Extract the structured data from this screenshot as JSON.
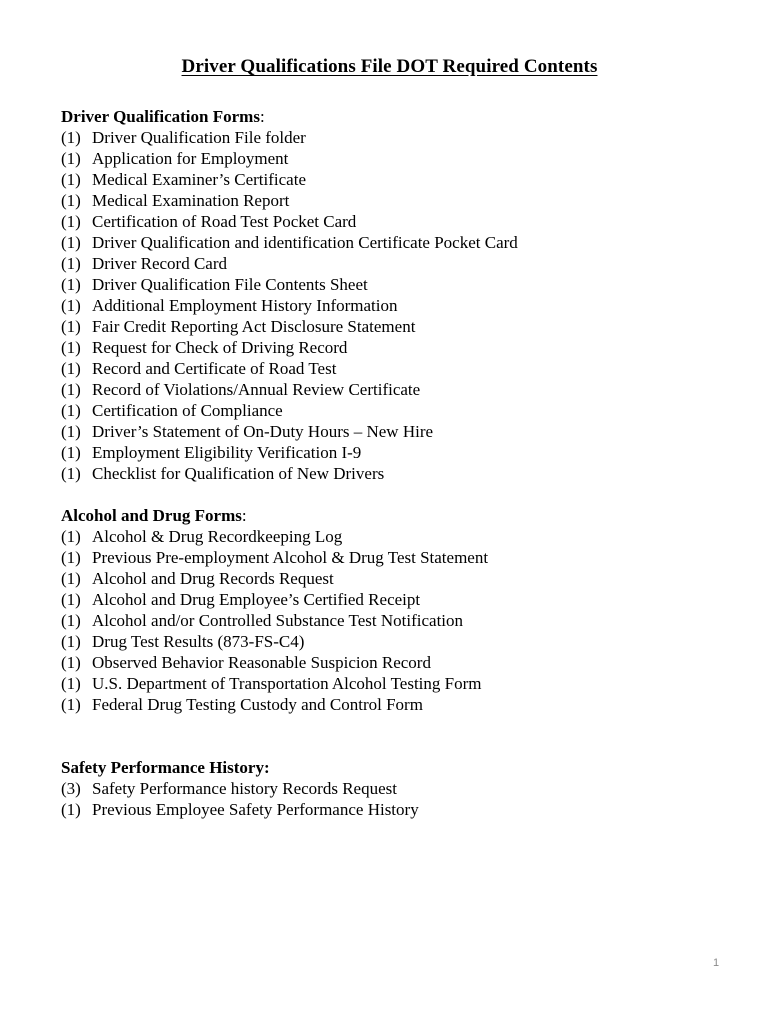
{
  "document": {
    "title": "Driver Qualifications File DOT Required Contents",
    "page_number": "1",
    "sections": [
      {
        "heading": "Driver Qualification Forms",
        "heading_colon": ":",
        "colon_bold": false,
        "items": [
          {
            "count": "(1)",
            "label": "Driver Qualification File folder"
          },
          {
            "count": "(1)",
            "label": "Application for Employment"
          },
          {
            "count": "(1)",
            "label": "Medical Examiner’s Certificate"
          },
          {
            "count": "(1)",
            "label": "Medical Examination Report"
          },
          {
            "count": "(1)",
            "label": "Certification of Road Test Pocket Card"
          },
          {
            "count": "(1)",
            "label": "Driver Qualification and identification Certificate Pocket Card"
          },
          {
            "count": "(1)",
            "label": "Driver Record Card"
          },
          {
            "count": "(1)",
            "label": "Driver Qualification File Contents Sheet"
          },
          {
            "count": "(1)",
            "label": "Additional Employment History Information"
          },
          {
            "count": "(1)",
            "label": "Fair Credit Reporting Act Disclosure Statement"
          },
          {
            "count": "(1)",
            "label": "Request for Check of Driving Record"
          },
          {
            "count": "(1)",
            "label": "Record and Certificate of Road Test"
          },
          {
            "count": "(1)",
            "label": "Record of Violations/Annual Review Certificate"
          },
          {
            "count": "(1)",
            "label": "Certification of Compliance"
          },
          {
            "count": "(1)",
            "label": "Driver’s Statement of On-Duty Hours – New Hire"
          },
          {
            "count": "(1)",
            "label": "Employment Eligibility Verification I-9"
          },
          {
            "count": "(1)",
            "label": "Checklist for Qualification of New Drivers"
          }
        ]
      },
      {
        "heading": "Alcohol and Drug Forms",
        "heading_colon": ":",
        "colon_bold": false,
        "items": [
          {
            "count": "(1)",
            "label": "Alcohol & Drug Recordkeeping Log"
          },
          {
            "count": "(1)",
            "label": "Previous Pre-employment Alcohol & Drug Test Statement"
          },
          {
            "count": "(1)",
            "label": "Alcohol and Drug Records Request"
          },
          {
            "count": "(1)",
            "label": "Alcohol and Drug Employee’s Certified Receipt"
          },
          {
            "count": "(1)",
            "label": "Alcohol and/or Controlled Substance Test Notification"
          },
          {
            "count": "(1)",
            "label": "Drug Test Results (873-FS-C4)"
          },
          {
            "count": "(1)",
            "label": "Observed Behavior Reasonable Suspicion Record"
          },
          {
            "count": "(1)",
            "label": "U.S. Department of Transportation Alcohol Testing Form"
          },
          {
            "count": "(1)",
            "label": "Federal Drug Testing Custody and Control Form"
          }
        ]
      },
      {
        "heading": "Safety Performance History",
        "heading_colon": ":",
        "colon_bold": true,
        "items": [
          {
            "count": "(3)",
            "label": "Safety Performance history Records Request"
          },
          {
            "count": "(1)",
            "label": "Previous Employee Safety Performance History"
          }
        ]
      }
    ]
  }
}
